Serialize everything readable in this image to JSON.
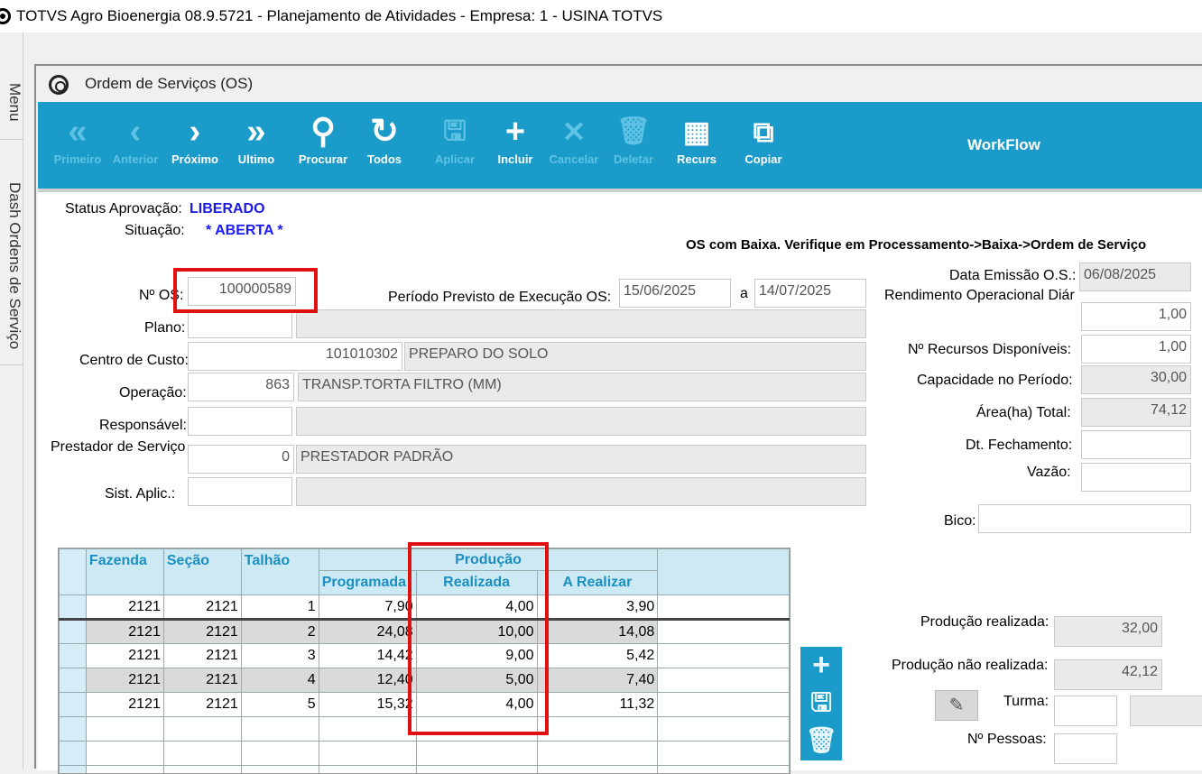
{
  "app": {
    "title": "TOTVS Agro Bioenergia 08.9.5721 - Planejamento de Atividades  - Empresa: 1 - USINA TOTVS"
  },
  "left_tabs": [
    "Menu",
    "Dash Ordens de Serviço"
  ],
  "window": {
    "title": "Ordem de Serviços (OS)"
  },
  "toolbar": {
    "buttons": [
      {
        "label": "Primeiro",
        "glyph": "«",
        "enabled": false
      },
      {
        "label": "Anterior",
        "glyph": "‹",
        "enabled": false
      },
      {
        "label": "Próximo",
        "glyph": "›",
        "enabled": true
      },
      {
        "label": "Ultimo",
        "glyph": "»",
        "enabled": true
      },
      {
        "label": "Procurar",
        "glyph": "⚲",
        "enabled": true
      },
      {
        "label": "Todos",
        "glyph": "↻",
        "enabled": true
      },
      {
        "label": "Aplicar",
        "glyph": "🖫",
        "enabled": false
      },
      {
        "label": "Incluir",
        "glyph": "+",
        "enabled": true
      },
      {
        "label": "Cancelar",
        "glyph": "✕",
        "enabled": false
      },
      {
        "label": "Deletar",
        "glyph": "🗑",
        "enabled": false
      },
      {
        "label": "Recurs",
        "glyph": "▦",
        "enabled": true
      },
      {
        "label": "Copiar",
        "glyph": "⧉",
        "enabled": true
      }
    ],
    "workflow": "WorkFlow"
  },
  "status": {
    "aprovacao_label": "Status Aprovação:",
    "aprovacao_value": "LIBERADO",
    "situacao_label": "Situação:",
    "situacao_value": "* ABERTA *",
    "warning": "OS com Baixa. Verifique em Processamento->Baixa->Ordem de Serviço"
  },
  "form": {
    "nos_label": "Nº OS:",
    "nos_value": "100000589",
    "periodo_label": "Período Previsto de Execução OS:",
    "periodo_inicio": "15/06/2025",
    "periodo_sep": "a",
    "periodo_fim": "14/07/2025",
    "plano_label": "Plano:",
    "centro_label": "Centro de Custo:",
    "centro_code": "101010302",
    "centro_desc": "PREPARO DO SOLO",
    "operacao_label": "Operação:",
    "operacao_code": "863",
    "operacao_desc": "TRANSP.TORTA FILTRO (MM)",
    "responsavel_label": "Responsável:",
    "prestador_label": "Prestador de Serviço",
    "prestador_code": "0",
    "prestador_desc": "PRESTADOR PADRÃO",
    "sist_label": "Sist. Aplic.:"
  },
  "right": {
    "emissao_label": "Data Emissão O.S.:",
    "emissao_value": "06/08/2025",
    "rendimento_label": "Rendimento Operacional Diár",
    "rendimento_value": "1,00",
    "recursos_label": "Nº Recursos Disponíveis:",
    "recursos_value": "1,00",
    "capacidade_label": "Capacidade no Período:",
    "capacidade_value": "30,00",
    "area_label": "Área(ha) Total:",
    "area_value": "74,12",
    "fechamento_label": "Dt. Fechamento:",
    "vazao_label": "Vazão:",
    "bico_label": "Bico:",
    "prod_realizada_label": "Produção realizada:",
    "prod_realizada_value": "32,00",
    "prod_nao_label": "Produção não realizada:",
    "prod_nao_value": "42,12",
    "turma_label": "Turma:",
    "pessoas_label": "Nº Pessoas:"
  },
  "grid": {
    "headers": {
      "fazenda": "Fazenda",
      "secao": "Seção",
      "talhao": "Talhão",
      "producao": "Produção",
      "programada": "Programada",
      "realizada": "Realizada",
      "a_realizar": "A Realizar"
    },
    "rows": [
      [
        "2121",
        "2121",
        "1",
        "7,90",
        "4,00",
        "3,90"
      ],
      [
        "2121",
        "2121",
        "2",
        "24,08",
        "10,00",
        "14,08"
      ],
      [
        "2121",
        "2121",
        "3",
        "14,42",
        "9,00",
        "5,42"
      ],
      [
        "2121",
        "2121",
        "4",
        "12,40",
        "5,00",
        "7,40"
      ],
      [
        "2121",
        "2121",
        "5",
        "15,32",
        "4,00",
        "11,32"
      ]
    ]
  }
}
